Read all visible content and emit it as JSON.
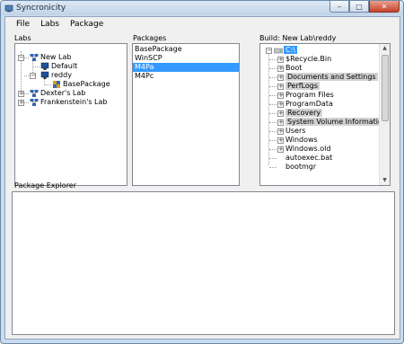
{
  "window": {
    "title": "Syncronicity"
  },
  "menu": [
    "File",
    "Labs",
    "Package"
  ],
  "labs": {
    "label": "Labs",
    "tree": [
      {
        "label": "New Lab"
      },
      {
        "label": "Default"
      },
      {
        "label": "reddy"
      },
      {
        "label": "BasePackage"
      },
      {
        "label": "Dexter's Lab"
      },
      {
        "label": "Frankenstein's Lab"
      }
    ]
  },
  "packages": {
    "label": "Packages",
    "items": [
      "BasePackage",
      "WinSCP",
      "M4Pa",
      "M4Pc"
    ],
    "selected": "M4Pa"
  },
  "build": {
    "label": "Build: New Lab\\reddy",
    "root": "C:\\",
    "items": [
      "$Recycle.Bin",
      "Boot",
      "Documents and Settings",
      "PerfLogs",
      "Program Files",
      "ProgramData",
      "Recovery",
      "System Volume Information",
      "Users",
      "Windows",
      "Windows.old",
      "autoexec.bat",
      "bootmgr"
    ],
    "highlighted": [
      "Documents and Settings",
      "PerfLogs",
      "Recovery",
      "System Volume Information"
    ]
  },
  "explorer": {
    "label": "Package Explorer"
  },
  "colors": {
    "selection": "#3399ff",
    "highlight": "#d2d2d2"
  },
  "icons": {
    "lab": "network-computers-icon",
    "machine": "monitor-icon",
    "package": "package-icon",
    "drive": "drive-icon"
  }
}
